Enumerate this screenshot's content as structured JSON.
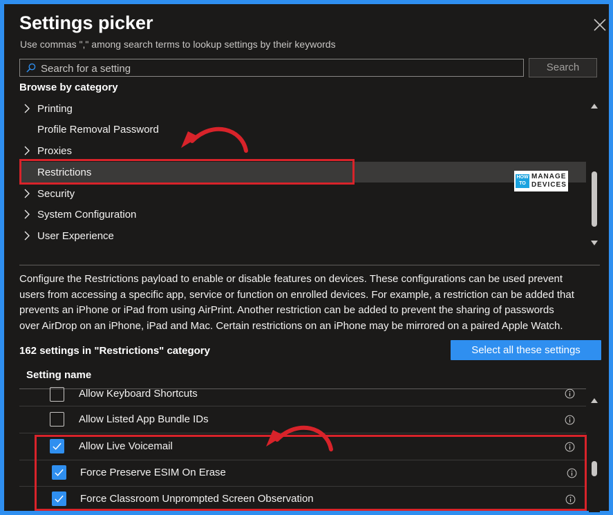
{
  "header": {
    "title": "Settings picker",
    "subtitle": "Use commas \",\" among search terms to lookup settings by their keywords"
  },
  "search": {
    "placeholder": "Search for a setting",
    "button_label": "Search"
  },
  "browse": {
    "label": "Browse by category",
    "categories": [
      {
        "label": "Printing",
        "expandable": true
      },
      {
        "label": "Profile Removal Password",
        "expandable": false
      },
      {
        "label": "Proxies",
        "expandable": true
      },
      {
        "label": "Restrictions",
        "expandable": false,
        "selected": true
      },
      {
        "label": "Security",
        "expandable": true
      },
      {
        "label": "System Configuration",
        "expandable": true
      },
      {
        "label": "User Experience",
        "expandable": true
      }
    ]
  },
  "description": {
    "lines": [
      "Configure the Restrictions payload to enable or disable features on devices. These configurations can be used prevent",
      "users from accessing a specific app, service or function on enrolled devices. For example, a restriction can be added that",
      "prevents an iPhone or iPad from using AirPrint. Another restriction can be added to prevent the sharing of passwords",
      "over AirDrop on an iPhone, iPad and Mac. Certain restrictions on an iPhone may be mirrored on a paired Apple Watch."
    ]
  },
  "results": {
    "count_label": "162 settings in \"Restrictions\" category",
    "select_all_label": "Select all these settings",
    "column_header": "Setting name",
    "rows": [
      {
        "name": "Allow Keyboard Shortcuts",
        "checked": false
      },
      {
        "name": "Allow Listed App Bundle IDs",
        "checked": false
      },
      {
        "name": "Allow Live Voicemail",
        "checked": true
      },
      {
        "name": "Force Preserve ESIM On Erase",
        "checked": true
      },
      {
        "name": "Force Classroom Unprompted Screen Observation",
        "checked": true
      }
    ]
  },
  "watermark": {
    "left": "HOW TO",
    "line1": "MANAGE",
    "line2": "DEVICES"
  },
  "colors": {
    "accent": "#2f8ff0",
    "highlight": "#d8232a",
    "background": "#1b1a19"
  }
}
